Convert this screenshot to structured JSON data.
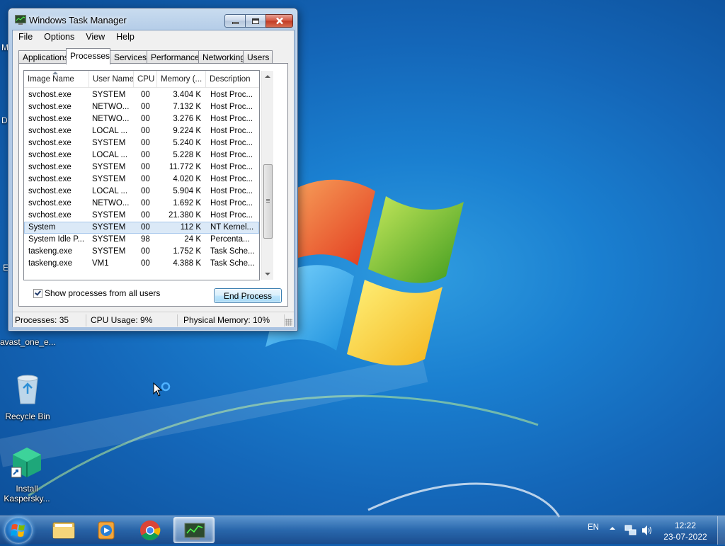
{
  "window": {
    "title": "Windows Task Manager",
    "menu": [
      "File",
      "Options",
      "View",
      "Help"
    ],
    "tabs": [
      "Applications",
      "Processes",
      "Services",
      "Performance",
      "Networking",
      "Users"
    ],
    "active_tab": "Processes",
    "columns": [
      "Image Name",
      "User Name",
      "CPU",
      "Memory (...",
      "Description"
    ],
    "processes": [
      {
        "name": "svchost.exe",
        "user": "SYSTEM",
        "cpu": "00",
        "mem": "3.404 K",
        "desc": "Host Proc..."
      },
      {
        "name": "svchost.exe",
        "user": "NETWO...",
        "cpu": "00",
        "mem": "7.132 K",
        "desc": "Host Proc..."
      },
      {
        "name": "svchost.exe",
        "user": "NETWO...",
        "cpu": "00",
        "mem": "3.276 K",
        "desc": "Host Proc..."
      },
      {
        "name": "svchost.exe",
        "user": "LOCAL ...",
        "cpu": "00",
        "mem": "9.224 K",
        "desc": "Host Proc..."
      },
      {
        "name": "svchost.exe",
        "user": "SYSTEM",
        "cpu": "00",
        "mem": "5.240 K",
        "desc": "Host Proc..."
      },
      {
        "name": "svchost.exe",
        "user": "LOCAL ...",
        "cpu": "00",
        "mem": "5.228 K",
        "desc": "Host Proc..."
      },
      {
        "name": "svchost.exe",
        "user": "SYSTEM",
        "cpu": "00",
        "mem": "11.772 K",
        "desc": "Host Proc..."
      },
      {
        "name": "svchost.exe",
        "user": "SYSTEM",
        "cpu": "00",
        "mem": "4.020 K",
        "desc": "Host Proc..."
      },
      {
        "name": "svchost.exe",
        "user": "LOCAL ...",
        "cpu": "00",
        "mem": "5.904 K",
        "desc": "Host Proc..."
      },
      {
        "name": "svchost.exe",
        "user": "NETWO...",
        "cpu": "00",
        "mem": "1.692 K",
        "desc": "Host Proc..."
      },
      {
        "name": "svchost.exe",
        "user": "SYSTEM",
        "cpu": "00",
        "mem": "21.380 K",
        "desc": "Host Proc..."
      },
      {
        "name": "System",
        "user": "SYSTEM",
        "cpu": "00",
        "mem": "112 K",
        "desc": "NT Kernel...",
        "selected": true
      },
      {
        "name": "System Idle P...",
        "user": "SYSTEM",
        "cpu": "98",
        "mem": "24 K",
        "desc": "Percenta..."
      },
      {
        "name": "taskeng.exe",
        "user": "SYSTEM",
        "cpu": "00",
        "mem": "1.752 K",
        "desc": "Task Sche..."
      },
      {
        "name": "taskeng.exe",
        "user": "VM1",
        "cpu": "00",
        "mem": "4.388 K",
        "desc": "Task Sche..."
      }
    ],
    "show_all_label": "Show processes from all users",
    "show_all_checked": true,
    "end_process_label": "End Process",
    "status": {
      "processes": "Processes: 35",
      "cpu": "CPU Usage: 9%",
      "memory": "Physical Memory: 10%"
    }
  },
  "desktop": {
    "edge_labels": [
      "M",
      "D",
      "E"
    ],
    "icons": [
      {
        "label": "avast_one_e...",
        "icon": "installer-icon"
      },
      {
        "label": "Recycle Bin",
        "icon": "recycle-bin-icon"
      },
      {
        "label": "Install Kaspersky...",
        "icon": "kaspersky-icon"
      }
    ]
  },
  "taskbar": {
    "pinned": [
      "windows-explorer-icon",
      "media-player-icon",
      "chrome-icon",
      "task-manager-icon"
    ],
    "language": "EN",
    "time": "12:22",
    "date": "23-07-2022"
  },
  "colors": {
    "desktop_blue": "#1a7fd0",
    "selection": "#dbe9f7",
    "close_red": "#c13a24"
  }
}
